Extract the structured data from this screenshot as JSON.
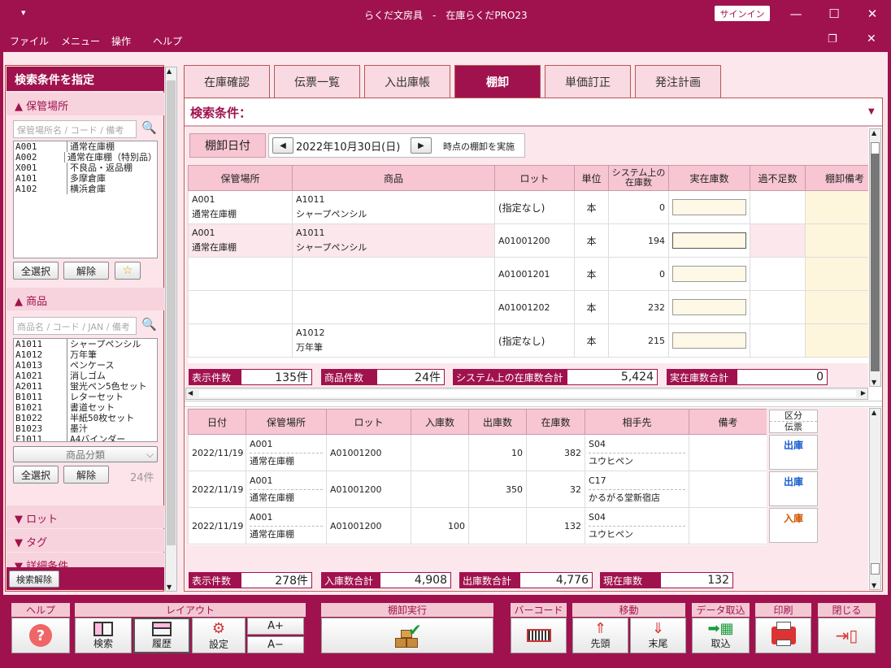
{
  "window": {
    "title": "らくだ文房具　-　在庫らくだPRO23",
    "signin": "サインイン",
    "sysmenu": "▾"
  },
  "menu": [
    "ファイル",
    "メニュー",
    "操作",
    "ヘルプ"
  ],
  "left": {
    "header": "検索条件を指定",
    "location": {
      "title": "保管場所",
      "placeholder": "保管場所名 / コード / 備考",
      "items": [
        {
          "c": "A001",
          "n": "通常在庫棚"
        },
        {
          "c": "A002",
          "n": "通常在庫棚（特別品）"
        },
        {
          "c": "X001",
          "n": "不良品・返品棚"
        },
        {
          "c": "A101",
          "n": "多摩倉庫"
        },
        {
          "c": "A102",
          "n": "横浜倉庫"
        }
      ],
      "select_all": "全選択",
      "clear": "解除"
    },
    "product": {
      "title": "商品",
      "placeholder": "商品名 / コード / JAN / 備考",
      "items": [
        {
          "c": "A1011",
          "n": "シャープペンシル"
        },
        {
          "c": "A1012",
          "n": "万年筆"
        },
        {
          "c": "A1013",
          "n": "ペンケース"
        },
        {
          "c": "A1021",
          "n": "消しゴム"
        },
        {
          "c": "A2011",
          "n": "蛍光ペン5色セット"
        },
        {
          "c": "B1011",
          "n": "レターセット"
        },
        {
          "c": "B1021",
          "n": "書道セット"
        },
        {
          "c": "B1022",
          "n": "半紙50枚セット"
        },
        {
          "c": "B1023",
          "n": "墨汁"
        },
        {
          "c": "F1011",
          "n": "A4バインダー"
        }
      ],
      "category": "商品分類",
      "select_all": "全選択",
      "clear": "解除",
      "count": "24件"
    },
    "lot": "ロット",
    "tag": "タグ",
    "detail": "詳細条件",
    "reset": "検索解除"
  },
  "tabs": [
    "在庫確認",
    "伝票一覧",
    "入出庫帳",
    "棚卸",
    "単価訂正",
    "発注計画"
  ],
  "active_tab": "棚卸",
  "search_label": "検索条件：",
  "date": {
    "label": "棚卸日付",
    "value": "2022年10月30日(日)",
    "suffix": "時点の棚卸を実施"
  },
  "upper": {
    "headers": [
      "保管場所",
      "商品",
      "ロット",
      "単位",
      "システム上の在庫数",
      "実在庫数",
      "過不足数",
      "棚卸備考"
    ],
    "rows": [
      {
        "loc_code": "A001",
        "loc_name": "通常在庫棚",
        "prod_code": "A1011",
        "prod_name": "シャープペンシル",
        "lot": "(指定なし)",
        "unit": "本",
        "sys": "0"
      },
      {
        "loc_code": "A001",
        "loc_name": "通常在庫棚",
        "prod_code": "A1011",
        "prod_name": "シャープペンシル",
        "lot": "A01001200",
        "unit": "本",
        "sys": "194"
      },
      {
        "loc_code": "",
        "loc_name": "",
        "prod_code": "",
        "prod_name": "",
        "lot": "A01001201",
        "unit": "本",
        "sys": "0"
      },
      {
        "loc_code": "",
        "loc_name": "",
        "prod_code": "",
        "prod_name": "",
        "lot": "A01001202",
        "unit": "本",
        "sys": "232"
      },
      {
        "loc_code": "",
        "loc_name": "",
        "prod_code": "A1012",
        "prod_name": "万年筆",
        "lot": "(指定なし)",
        "unit": "本",
        "sys": "215"
      }
    ],
    "summary": [
      {
        "label": "表示件数",
        "value": "135件"
      },
      {
        "label": "商品件数",
        "value": "24件"
      },
      {
        "label": "システム上の在庫数合計",
        "value": "5,424"
      },
      {
        "label": "実在庫数合計",
        "value": "0"
      }
    ]
  },
  "lower": {
    "headers": [
      "日付",
      "保管場所",
      "ロット",
      "入庫数",
      "出庫数",
      "在庫数",
      "相手先",
      "備考"
    ],
    "side": [
      "区分",
      "伝票"
    ],
    "rows": [
      {
        "date": "2022/11/19",
        "loc_code": "A001",
        "loc_name": "通常在庫棚",
        "lot": "A01001200",
        "in": "",
        "out": "10",
        "stock": "382",
        "p_code": "S04",
        "p_name": "ユウヒペン",
        "kind": "出庫"
      },
      {
        "date": "2022/11/19",
        "loc_code": "A001",
        "loc_name": "通常在庫棚",
        "lot": "A01001200",
        "in": "",
        "out": "350",
        "stock": "32",
        "p_code": "C17",
        "p_name": "かるがる堂新宿店",
        "kind": "出庫"
      },
      {
        "date": "2022/11/19",
        "loc_code": "A001",
        "loc_name": "通常在庫棚",
        "lot": "A01001200",
        "in": "100",
        "out": "",
        "stock": "132",
        "p_code": "S04",
        "p_name": "ユウヒペン",
        "kind": "入庫"
      }
    ],
    "summary": [
      {
        "label": "表示件数",
        "value": "278件"
      },
      {
        "label": "入庫数合計",
        "value": "4,908"
      },
      {
        "label": "出庫数合計",
        "value": "4,776"
      },
      {
        "label": "現在庫数",
        "value": "132"
      }
    ]
  },
  "toolbar": {
    "help": "ヘルプ",
    "layout": "レイアウト",
    "search": "検索",
    "history": "履歴",
    "settings": "設定",
    "font_up": "A+",
    "font_down": "A−",
    "execute": "棚卸実行",
    "barcode": "バーコード",
    "move": "移動",
    "first": "先頭",
    "last": "末尾",
    "import": "データ取込",
    "import_btn": "取込",
    "print": "印刷",
    "close": "閉じる"
  }
}
